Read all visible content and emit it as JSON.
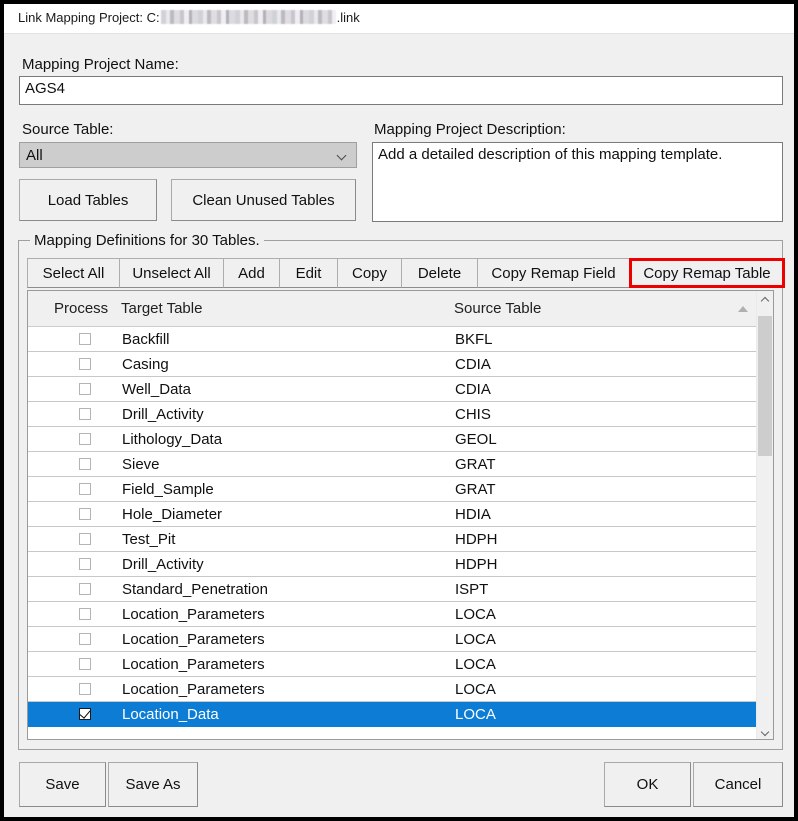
{
  "window": {
    "title_prefix": "Link Mapping Project: C:",
    "title_suffix": ".link",
    "redacted_path_note": "blurred"
  },
  "form": {
    "project_name_label": "Mapping Project Name:",
    "project_name_value": "AGS4",
    "source_table_label": "Source Table:",
    "source_table_value": "All",
    "description_label": "Mapping Project Description:",
    "description_value": "Add a detailed description of this mapping template.",
    "load_tables_label": "Load Tables",
    "clean_unused_tables_label": "Clean Unused Tables"
  },
  "group": {
    "title": "Mapping Definitions for 30 Tables.",
    "highlight_color": "#ee0000",
    "toolbar": [
      {
        "label": "Select All",
        "width": 93,
        "highlighted": false
      },
      {
        "label": "Unselect All",
        "width": 105,
        "highlighted": false
      },
      {
        "label": "Add",
        "width": 57,
        "highlighted": false
      },
      {
        "label": "Edit",
        "width": 59,
        "highlighted": false
      },
      {
        "label": "Copy",
        "width": 65,
        "highlighted": false
      },
      {
        "label": "Delete",
        "width": 77,
        "highlighted": false
      },
      {
        "label": "Copy Remap Field",
        "width": 153,
        "highlighted": false
      },
      {
        "label": "Copy Remap Table",
        "width": 156,
        "highlighted": true
      }
    ]
  },
  "grid": {
    "columns": [
      "Process",
      "Target Table",
      "Source Table"
    ],
    "selection_color": "#0c7cd5",
    "rows": [
      {
        "checked": false,
        "target": "Backfill",
        "source": "BKFL",
        "selected": false
      },
      {
        "checked": false,
        "target": "Casing",
        "source": "CDIA",
        "selected": false
      },
      {
        "checked": false,
        "target": "Well_Data",
        "source": "CDIA",
        "selected": false
      },
      {
        "checked": false,
        "target": "Drill_Activity",
        "source": "CHIS",
        "selected": false
      },
      {
        "checked": false,
        "target": "Lithology_Data",
        "source": "GEOL",
        "selected": false
      },
      {
        "checked": false,
        "target": "Sieve",
        "source": "GRAT",
        "selected": false
      },
      {
        "checked": false,
        "target": "Field_Sample",
        "source": "GRAT",
        "selected": false
      },
      {
        "checked": false,
        "target": "Hole_Diameter",
        "source": "HDIA",
        "selected": false
      },
      {
        "checked": false,
        "target": "Test_Pit",
        "source": "HDPH",
        "selected": false
      },
      {
        "checked": false,
        "target": "Drill_Activity",
        "source": "HDPH",
        "selected": false
      },
      {
        "checked": false,
        "target": "Standard_Penetration",
        "source": "ISPT",
        "selected": false
      },
      {
        "checked": false,
        "target": "Location_Parameters",
        "source": "LOCA",
        "selected": false
      },
      {
        "checked": false,
        "target": "Location_Parameters",
        "source": "LOCA",
        "selected": false
      },
      {
        "checked": false,
        "target": "Location_Parameters",
        "source": "LOCA",
        "selected": false
      },
      {
        "checked": false,
        "target": "Location_Parameters",
        "source": "LOCA",
        "selected": false
      },
      {
        "checked": true,
        "target": "Location_Data",
        "source": "LOCA",
        "selected": true
      }
    ]
  },
  "footer": {
    "save_label": "Save",
    "save_as_label": "Save As",
    "ok_label": "OK",
    "cancel_label": "Cancel"
  }
}
